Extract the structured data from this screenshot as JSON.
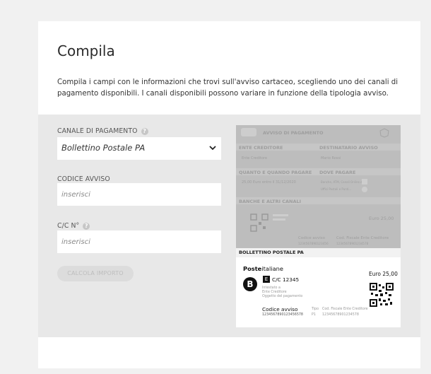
{
  "page": {
    "title": "Compila",
    "description": "Compila i campi con le informazioni che trovi sull'avviso cartaceo, scegliendo uno dei canali di pagamento disponibili. I canali disponibili possono variare in funzione della tipologia avviso."
  },
  "form": {
    "canale_label": "CANALE DI PAGAMENTO",
    "canale_value": "Bollettino Postale PA",
    "codice_label": "CODICE AVVISO",
    "codice_placeholder": "inserisci",
    "cc_label": "C/C N°",
    "cc_placeholder": "inserisci",
    "calc_button": "CALCOLA IMPORTO",
    "help_glyph": "?"
  },
  "avviso": {
    "header": "AVVISO DI PAGAMENTO",
    "ente_creditore": "ENTE CREDITORE",
    "ente_value": "Ente Creditore",
    "destinatario": "DESTINATARIO AVVISO",
    "destinatario_value": "Mario Rossi",
    "quanto": "QUANTO E QUANDO PAGARE",
    "quanto_value": "25,00 Euro entro il 31/12/2020",
    "dove": "DOVE PAGARE",
    "dove_line1": "Banche, ATM, Canali Online e...",
    "dove_line2": "Uffici Postali e Punti...",
    "banche": "BANCHE E ALTRI CANALI",
    "banche_euro": "Euro 25,00",
    "banche_codice_label": "Codice avviso",
    "banche_codice_value": "1234567890123456",
    "banche_cf_label": "Cod. Fiscale Ente Creditore",
    "banche_cf_value": "12345678901234578",
    "bollettino_header": "BOLLETTINO POSTALE PA",
    "brand_bold": "Poste",
    "brand_rest": "italiane",
    "euro": "Euro 25,00",
    "cc_text": "C/C 12345",
    "intestato_1": "Intestato a",
    "intestato_2": "Ente Creditore",
    "intestato_3": "Oggetto del pagamento",
    "codice_label": "Codice avviso",
    "codice_value": "1234567890123456578",
    "tipo_label": "Tipo",
    "tipo_value": "P1",
    "cf_label": "Cod. Fiscale Ente Creditore",
    "cf_value": "12345678901234578",
    "b_letter": "B",
    "e_letter": "E"
  },
  "colors": {
    "background": "#f1f1f1",
    "card": "#ffffff",
    "panel": "#e8e8e8",
    "avviso_gray": "#bdbdbd"
  },
  "icons": [
    "help-icon",
    "chevron-down-icon",
    "qr-code-icon",
    "bancoposta-icon"
  ]
}
